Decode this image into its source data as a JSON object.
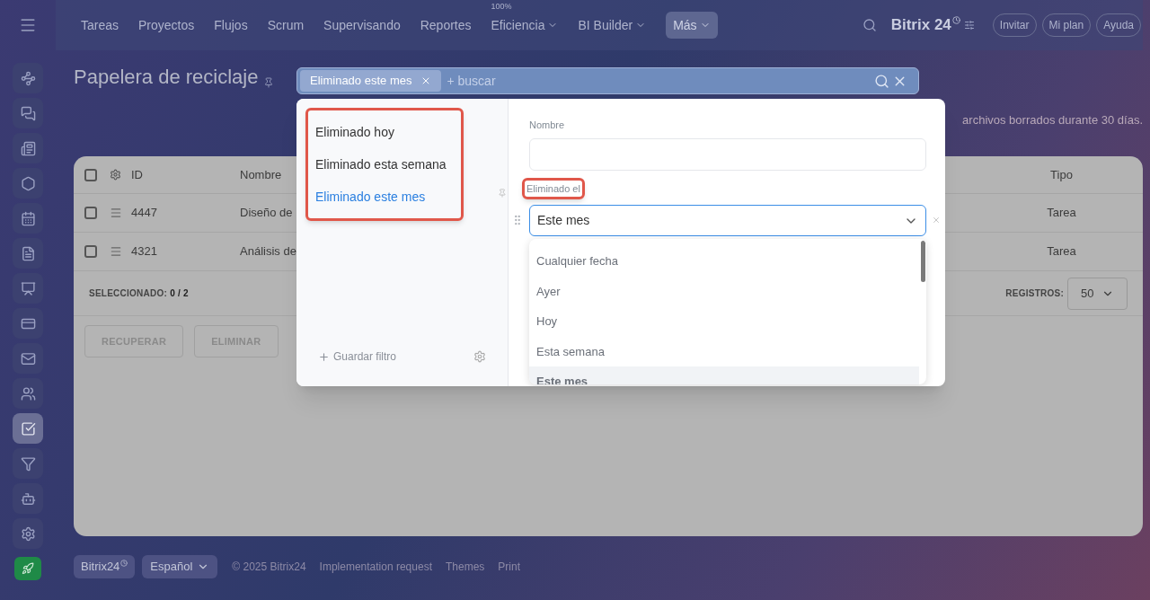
{
  "nav": {
    "items": [
      {
        "label": "Tareas",
        "selected": false
      },
      {
        "label": "Proyectos",
        "selected": false
      },
      {
        "label": "Flujos",
        "selected": false
      },
      {
        "label": "Scrum",
        "selected": false
      },
      {
        "label": "Supervisando",
        "selected": false
      },
      {
        "label": "Reportes",
        "selected": false
      },
      {
        "label": "Eficiencia",
        "badge": "100%",
        "dropdown": true,
        "selected": false
      },
      {
        "label": "BI Builder",
        "dropdown": true,
        "selected": false
      },
      {
        "label": "Más",
        "dropdown": true,
        "selected": true
      }
    ],
    "brand": {
      "name": "Bitrix",
      "number": "24"
    },
    "buttons": [
      "Invitar",
      "Mi plan",
      "Ayuda"
    ]
  },
  "sidebar": {
    "items": [
      {
        "selected": false
      },
      {
        "selected": false
      },
      {
        "selected": false
      },
      {
        "selected": false
      },
      {
        "selected": false
      },
      {
        "selected": false
      },
      {
        "selected": false
      },
      {
        "selected": false
      },
      {
        "selected": false
      },
      {
        "selected": false
      },
      {
        "selected": true
      },
      {
        "selected": false
      },
      {
        "selected": false
      },
      {
        "selected": false
      }
    ]
  },
  "page": {
    "title": "Papelera de reciclaje",
    "description": "archivos borrados durante 30 días."
  },
  "filter_bar": {
    "chip": "Eliminado este mes",
    "placeholder": "+ buscar"
  },
  "filter_popup": {
    "presets_highlighted": true,
    "presets": [
      {
        "label": "Eliminado hoy",
        "selected": false
      },
      {
        "label": "Eliminado esta semana",
        "selected": false
      },
      {
        "label": "Eliminado este mes",
        "selected": true
      }
    ],
    "save_filter": "Guardar filtro",
    "fields": [
      {
        "kind": "text",
        "label": "Nombre",
        "highlighted": false
      },
      {
        "kind": "select",
        "label": "Eliminado el",
        "highlighted": true,
        "value": "Este mes",
        "expanded": true,
        "options": [
          {
            "label": "Cualquier fecha",
            "selected": false
          },
          {
            "label": "Ayer",
            "selected": false
          },
          {
            "label": "Hoy",
            "selected": false
          },
          {
            "label": "Esta semana",
            "selected": false
          },
          {
            "label": "Este mes",
            "selected": true
          }
        ]
      }
    ]
  },
  "table": {
    "all_checked": false,
    "columns": [
      "ID",
      "Nombre",
      "Tipo"
    ],
    "rows": [
      {
        "checked": false,
        "id": "4447",
        "name": "Diseño de",
        "type": "Tarea"
      },
      {
        "checked": false,
        "id": "4321",
        "name": "Análisis de",
        "type": "Tarea"
      }
    ],
    "selected_label": "SELECCIONADO:",
    "selected_count": "0 / 2",
    "page_size_label": "REGISTROS:",
    "page_size": "50"
  },
  "actions": [
    {
      "label": "RECUPERAR",
      "disabled": true
    },
    {
      "label": "ELIMINAR",
      "disabled": true
    }
  ],
  "footer": {
    "brand": "Bitrix24",
    "language": "Español",
    "links": [
      "© 2025 Bitrix24",
      "Implementation request",
      "Themes",
      "Print"
    ]
  }
}
